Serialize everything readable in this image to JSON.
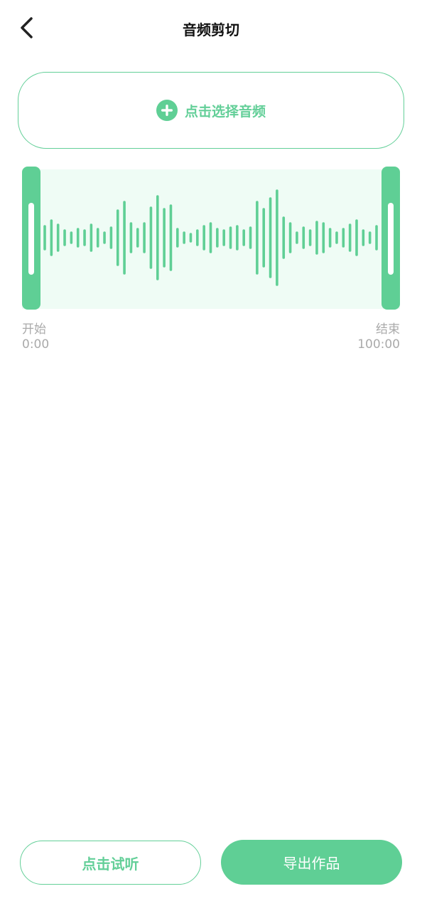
{
  "header": {
    "title": "音频剪切",
    "back_icon": "chevron-left-icon"
  },
  "select_audio": {
    "label": "点击选择音频",
    "icon": "plus-circle-icon"
  },
  "waveform": {
    "color": "#5fcf95",
    "background": "#effcf5",
    "bar_levels": [
      0.16,
      0.24,
      0.18,
      0.1,
      0.07,
      0.12,
      0.1,
      0.18,
      0.12,
      0.07,
      0.14,
      0.38,
      0.5,
      0.2,
      0.12,
      0.2,
      0.42,
      0.58,
      0.4,
      0.45,
      0.12,
      0.07,
      0.05,
      0.1,
      0.16,
      0.2,
      0.12,
      0.1,
      0.14,
      0.16,
      0.1,
      0.14,
      0.5,
      0.4,
      0.55,
      0.66,
      0.28,
      0.2,
      0.07,
      0.14,
      0.1,
      0.22,
      0.2,
      0.12,
      0.07,
      0.12,
      0.18,
      0.24,
      0.1,
      0.07,
      0.16
    ]
  },
  "range": {
    "start_label": "开始",
    "start_time": "0:00",
    "end_label": "结束",
    "end_time": "100:00"
  },
  "actions": {
    "preview_label": "点击试听",
    "export_label": "导出作品"
  },
  "colors": {
    "accent": "#5fcf95",
    "muted_text": "#aaaaaa"
  }
}
